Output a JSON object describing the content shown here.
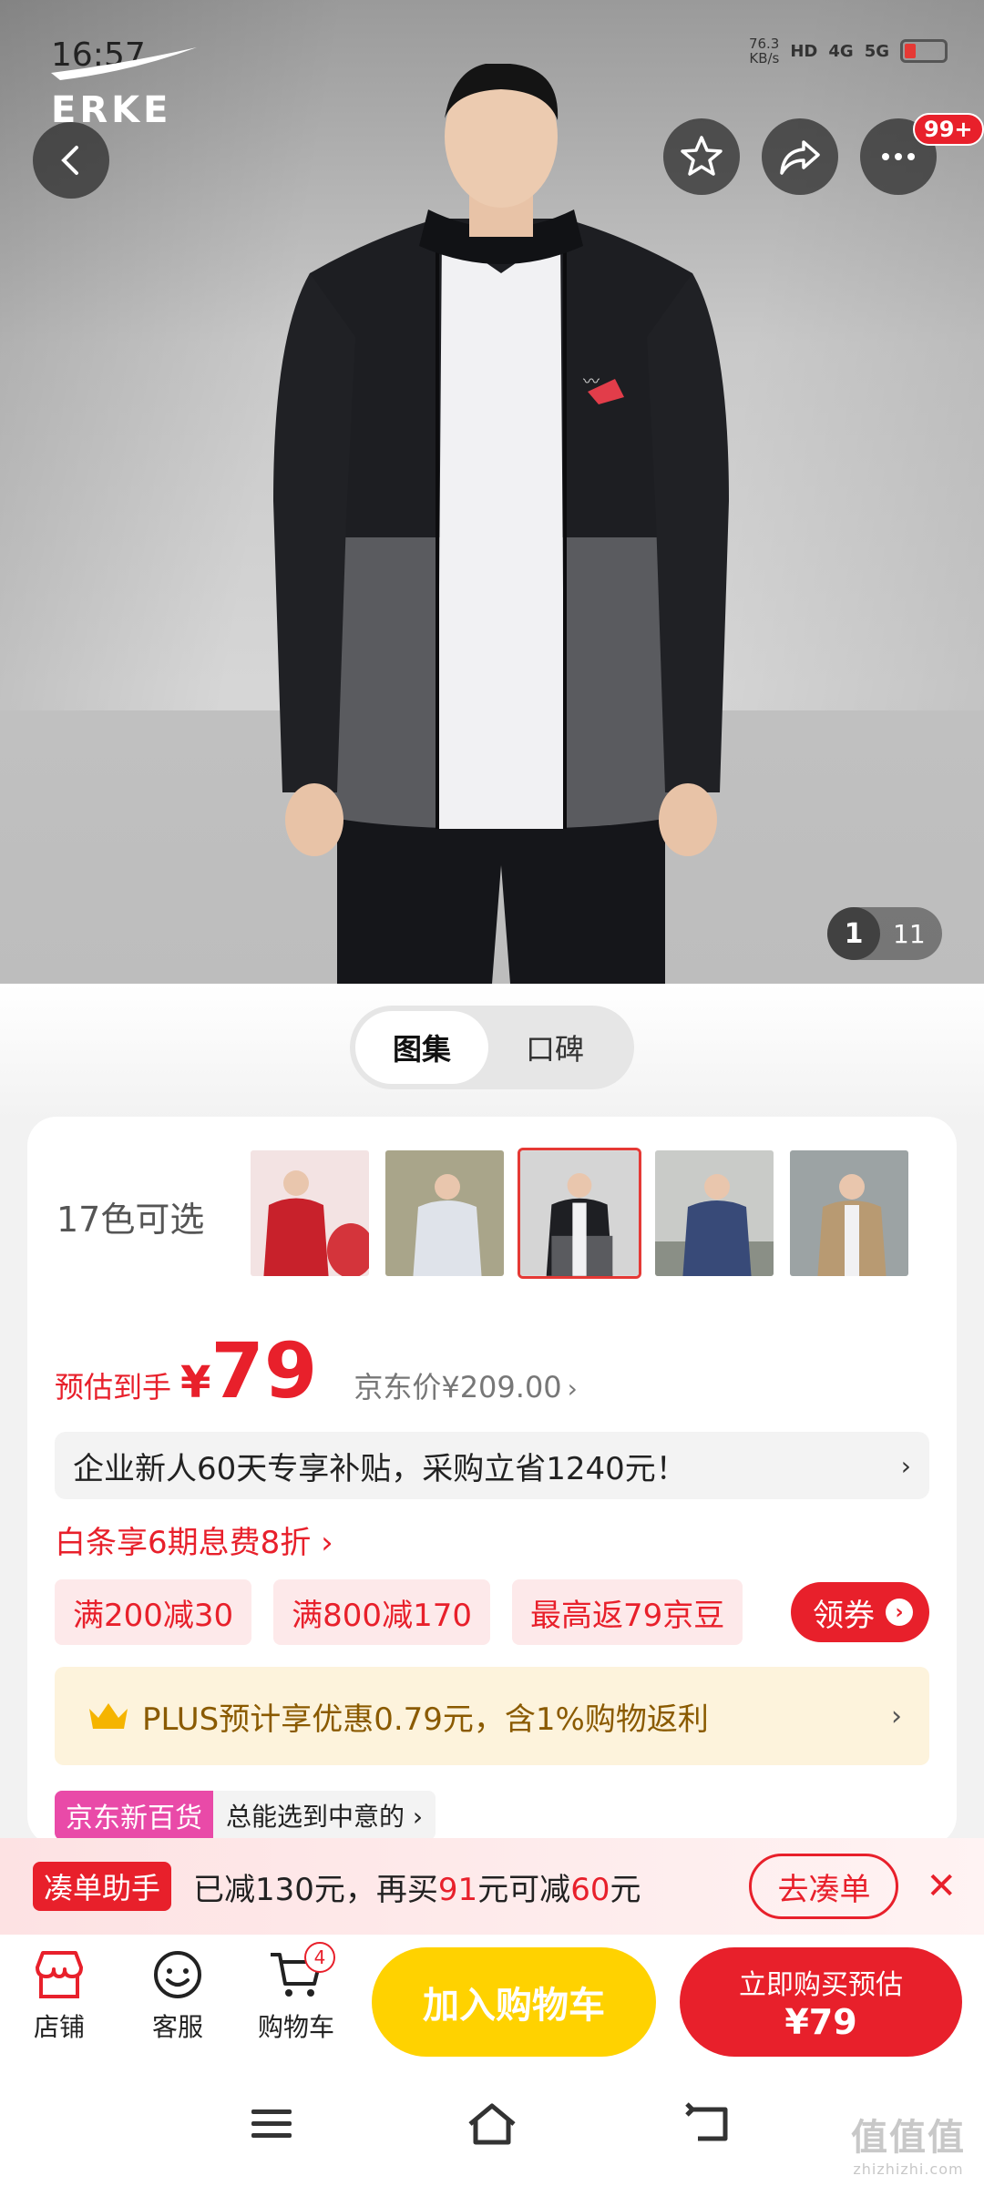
{
  "status": {
    "time": "16:57",
    "speed_value": "76.3",
    "speed_unit": "KB/s",
    "hd": "HD",
    "net1": "4G",
    "net2": "5G"
  },
  "brand": {
    "name": "ERKE"
  },
  "header": {
    "more_badge": "99+"
  },
  "gallery": {
    "current": "1",
    "total": "11"
  },
  "tabs": [
    {
      "label": "图集"
    },
    {
      "label": "口碑"
    }
  ],
  "variants": {
    "label": "17色可选",
    "colors": [
      "#c8212b",
      "#a9a58a",
      "#2a2a2a",
      "#6f7780",
      "#b89a72"
    ]
  },
  "price": {
    "estimate_label": "预估到手",
    "currency": "¥",
    "value": "79",
    "jd_price": "京东价¥209.00",
    "jd_arrow": "›"
  },
  "promo": {
    "text": "企业新人60天专享补贴，采购立省1240元！",
    "arrow": "›"
  },
  "baitiao": {
    "text": "白条享6期息费8折 ›"
  },
  "coupons": {
    "items": [
      "满200减30",
      "满800减170",
      "最高返79京豆"
    ],
    "get_label": "领券",
    "get_arrow": "›"
  },
  "plus": {
    "text": "PLUS预计享优惠0.79元，含1%购物返利",
    "arrow": "›"
  },
  "dept": {
    "tag": "京东新百货",
    "sub": "总能选到中意的 ›"
  },
  "bundle": {
    "tag": "凑单助手",
    "msg_prefix": "已减130元，再买",
    "msg_amount1": "91",
    "msg_mid": "元可减",
    "msg_amount2": "60",
    "msg_suffix": "元",
    "go_label": "去凑单",
    "close": "✕"
  },
  "bottom": {
    "shop_label": "店铺",
    "service_label": "客服",
    "cart_label": "购物车",
    "cart_count": "4",
    "add_cart_label": "加入购物车",
    "buy_line1": "立即购买预估",
    "buy_line2": "¥79"
  },
  "watermark": {
    "text": "值值值",
    "sub": "zhizhizhi.com"
  },
  "colors": {
    "accent_red": "#e8202b",
    "cart_yellow": "#ffd200",
    "plus_gold": "#8a5a00"
  }
}
